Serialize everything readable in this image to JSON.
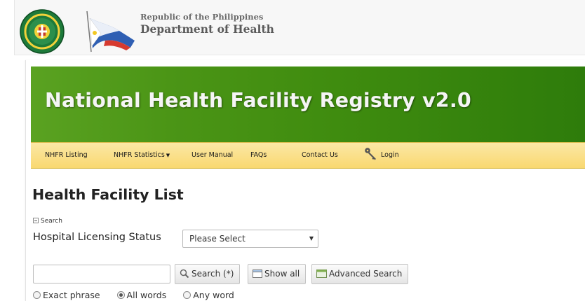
{
  "header": {
    "line1": "Republic of the Philippines",
    "line2": "Department of Health"
  },
  "banner": {
    "title": "National Health Facility Registry v2.0"
  },
  "nav": {
    "items": [
      {
        "label": "NHFR Listing"
      },
      {
        "label": "NHFR Statistics"
      },
      {
        "label": "User Manual"
      },
      {
        "label": "FAQs"
      },
      {
        "label": "Contact Us"
      },
      {
        "label": "Login"
      }
    ]
  },
  "main": {
    "heading": "Health Facility List",
    "search_toggle": "Search",
    "licensing_label": "Hospital Licensing Status",
    "licensing_select": "Please Select",
    "search_input_value": "",
    "buttons": {
      "search": "Search (*)",
      "show_all": "Show all",
      "advanced": "Advanced Search"
    },
    "match_options": [
      {
        "label": "Exact phrase",
        "selected": false
      },
      {
        "label": "All words",
        "selected": true
      },
      {
        "label": "Any word",
        "selected": false
      }
    ]
  },
  "colors": {
    "banner_green": "#4b9516",
    "nav_yellow": "#f9d870"
  }
}
